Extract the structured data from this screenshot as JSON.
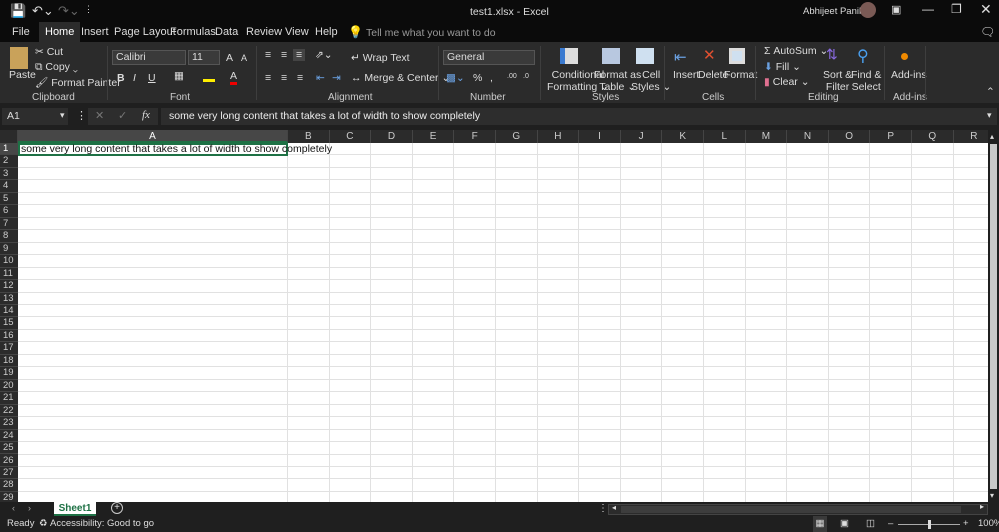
{
  "title": {
    "file": "test1.xlsx",
    "sep": "-",
    "app": "Excel",
    "user": "Abhijeet Panihar"
  },
  "tabs": [
    "File",
    "Home",
    "Insert",
    "Page Layout",
    "Formulas",
    "Data",
    "Review",
    "View",
    "Help"
  ],
  "tell_me": "Tell me what you want to do",
  "ribbon": {
    "clipboard": {
      "paste": "Paste",
      "cut": "Cut",
      "copy": "Copy",
      "format_painter": "Format Painter",
      "label": "Clipboard"
    },
    "font": {
      "name": "Calibri",
      "size": "11",
      "bold": "B",
      "italic": "I",
      "underline": "U",
      "grow": "A",
      "shrink": "A",
      "color": "A",
      "label": "Font"
    },
    "alignment": {
      "wrap": "Wrap Text",
      "merge": "Merge & Center",
      "label": "Alignment"
    },
    "number": {
      "format": "General",
      "percent": "%",
      "comma": ",",
      "label": "Number"
    },
    "styles": {
      "conditional": [
        "Conditional",
        "Formatting"
      ],
      "table": [
        "Format as",
        "Table"
      ],
      "cell": [
        "Cell",
        "Styles"
      ],
      "label": "Styles"
    },
    "cells": {
      "insert": "Insert",
      "delete": "Delete",
      "format": "Format",
      "label": "Cells"
    },
    "editing": {
      "autosum": "AutoSum",
      "fill": "Fill",
      "clear": "Clear",
      "sort": [
        "Sort &",
        "Filter"
      ],
      "find": [
        "Find &",
        "Select"
      ],
      "label": "Editing"
    },
    "addins": {
      "addins": "Add-ins",
      "label": "Add-ins"
    }
  },
  "formula_bar": {
    "name_box": "A1",
    "fx": "fx",
    "content": "some very long content that takes a lot of width to show completely"
  },
  "columns": [
    "A",
    "B",
    "C",
    "D",
    "E",
    "F",
    "G",
    "H",
    "I",
    "J",
    "K",
    "L",
    "M",
    "N",
    "O",
    "P",
    "Q",
    "R"
  ],
  "rows": [
    "1",
    "2",
    "3",
    "4",
    "5",
    "6",
    "7",
    "8",
    "9",
    "10",
    "11",
    "12",
    "13",
    "14",
    "15",
    "16",
    "17",
    "18",
    "19",
    "20",
    "21",
    "22",
    "23",
    "24",
    "25",
    "26",
    "27",
    "28",
    "29"
  ],
  "cell_a1": "some very long content that takes a lot of width to show completely",
  "sheet_tab": "Sheet1",
  "status": {
    "ready": "Ready",
    "accessibility": "Accessibility: Good to go",
    "zoom": "100%"
  }
}
